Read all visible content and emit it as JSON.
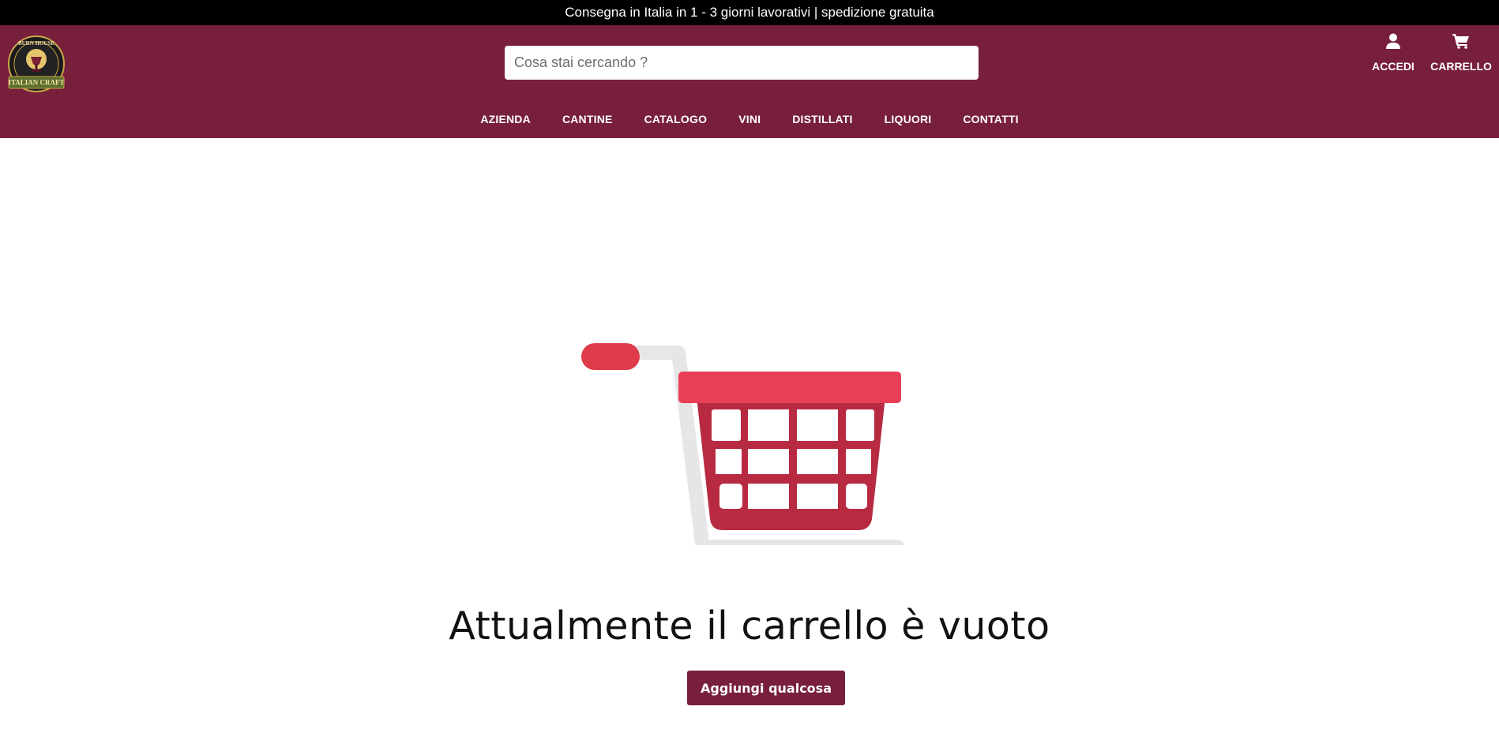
{
  "announcement": "Consegna in Italia in 1 - 3 giorni lavorativi | spedizione gratuita",
  "header": {
    "logo": {
      "top_text": "BURN HOUSE",
      "bottom_text": "ITALIAN CRAFT"
    },
    "search": {
      "placeholder": "Cosa stai cercando ?",
      "value": ""
    },
    "actions": [
      {
        "label": "ACCEDI",
        "icon": "user-icon"
      },
      {
        "label": "CARRELLO",
        "icon": "cart-icon"
      }
    ]
  },
  "nav": [
    "AZIENDA",
    "CANTINE",
    "CATALOGO",
    "VINI",
    "DISTILLATI",
    "LIQUORI",
    "CONTATTI"
  ],
  "main": {
    "illustration": "empty-cart-illustration",
    "title": "Attualmente il carrello è vuoto",
    "button_label": "Aggiungi qualcosa"
  },
  "colors": {
    "brand": "#781f3c",
    "topbar": "#000000",
    "cart_red": "#b82a42",
    "cart_rim": "#e83e57",
    "cart_frame": "#e6e6e6",
    "wheels": "#333333"
  }
}
